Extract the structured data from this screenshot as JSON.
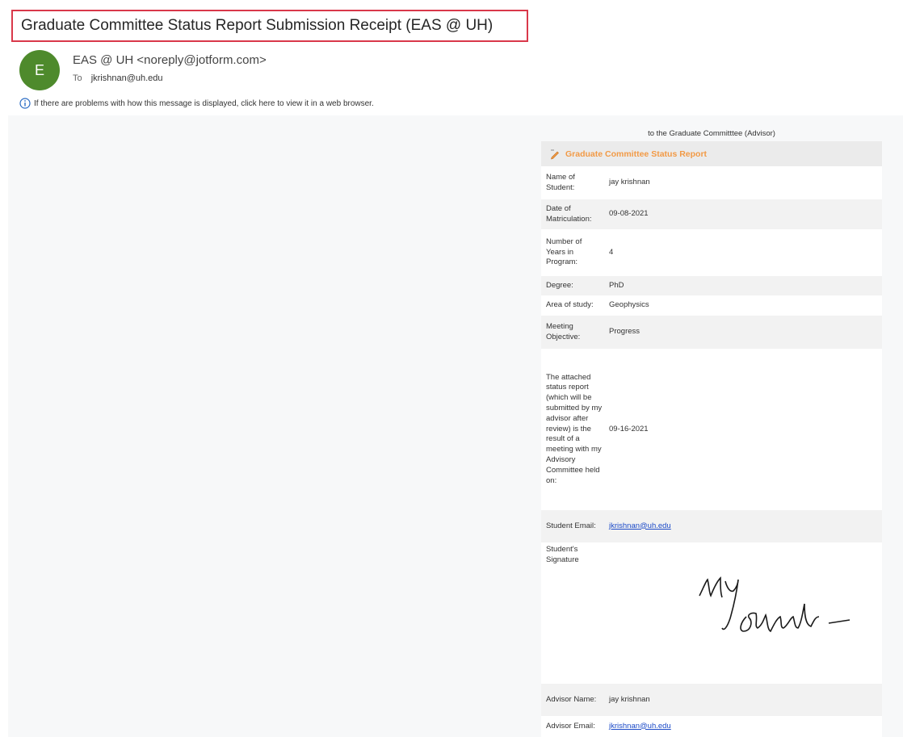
{
  "email": {
    "subject": "Graduate Committee Status Report Submission Receipt (EAS @ UH)",
    "avatar_letter": "E",
    "sender": "EAS @ UH <noreply@jotform.com>",
    "to_label": "To",
    "to_address": "jkrishnan@uh.edu",
    "info_message": "If there are problems with how this message is displayed, click here to view it in a web browser."
  },
  "form": {
    "caption": "to the Graduate Committtee (Advisor)",
    "title": "Graduate Committee Status Report",
    "rows": [
      {
        "label": "Name of Student:",
        "value": "jay krishnan"
      },
      {
        "label": "Date of Matriculation:",
        "value": "09-08-2021"
      },
      {
        "label": "Number of Years in Program:",
        "value": "4"
      },
      {
        "label": "Degree:",
        "value": "PhD"
      },
      {
        "label": "Area of study:",
        "value": "Geophysics"
      },
      {
        "label": "Meeting Objective:",
        "value": "Progress"
      },
      {
        "label": "The attached status report (which will be submitted by my advisor after review) is the result of a meeting with my Advisory Committee held on:",
        "value": "09-16-2021"
      },
      {
        "label": "Student Email:",
        "value": "jkrishnan@uh.edu"
      },
      {
        "label": "Student's Signature"
      },
      {
        "label": "Advisor Name:",
        "value": "jay krishnan"
      },
      {
        "label": "Advisor Email:",
        "value": "jkrishnan@uh.edu"
      }
    ]
  },
  "colors": {
    "avatar": "#4e8a2c",
    "subject_border": "#d9384a",
    "form_title": "#f29a46",
    "link": "#1a49c7"
  },
  "icons": [
    "info-icon",
    "pen-icon"
  ]
}
